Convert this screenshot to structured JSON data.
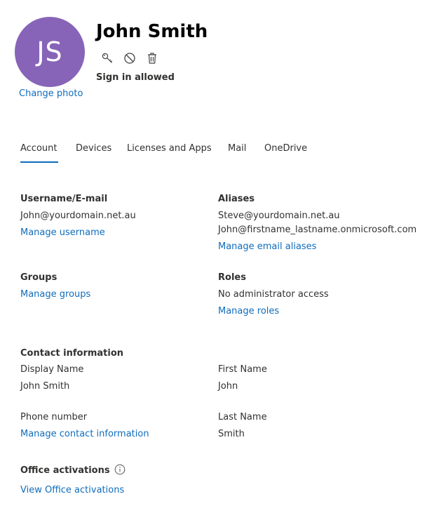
{
  "profile": {
    "initials": "JS",
    "avatar_color": "#8764b8",
    "change_photo_label": "Change photo",
    "name": "John Smith",
    "icons": [
      "key-icon",
      "block-icon",
      "trash-icon"
    ],
    "signin_status": "Sign in allowed"
  },
  "tabs": [
    {
      "label": "Account",
      "active": true
    },
    {
      "label": "Devices",
      "active": false
    },
    {
      "label": "Licenses and Apps",
      "active": false
    },
    {
      "label": "Mail",
      "active": false
    },
    {
      "label": "OneDrive",
      "active": false
    }
  ],
  "account": {
    "username": {
      "heading": "Username/E-mail",
      "value": "John@yourdomain.net.au",
      "link": "Manage username"
    },
    "aliases": {
      "heading": "Aliases",
      "values": [
        "Steve@yourdomain.net.au",
        "John@firstname_lastname.onmicrosoft.com"
      ],
      "link": "Manage email aliases"
    },
    "groups": {
      "heading": "Groups",
      "link": "Manage groups"
    },
    "roles": {
      "heading": "Roles",
      "value": "No administrator access",
      "link": "Manage roles"
    },
    "contact": {
      "heading": "Contact information",
      "display_name_label": "Display Name",
      "display_name_value": "John Smith",
      "first_name_label": "First Name",
      "first_name_value": "John",
      "phone_label": "Phone number",
      "contact_link": "Manage contact information",
      "last_name_label": "Last Name",
      "last_name_value": "Smith"
    },
    "office": {
      "heading": "Office activations",
      "link": "View Office activations"
    }
  },
  "colors": {
    "accent": "#0f6cbd",
    "text": "#323130"
  }
}
